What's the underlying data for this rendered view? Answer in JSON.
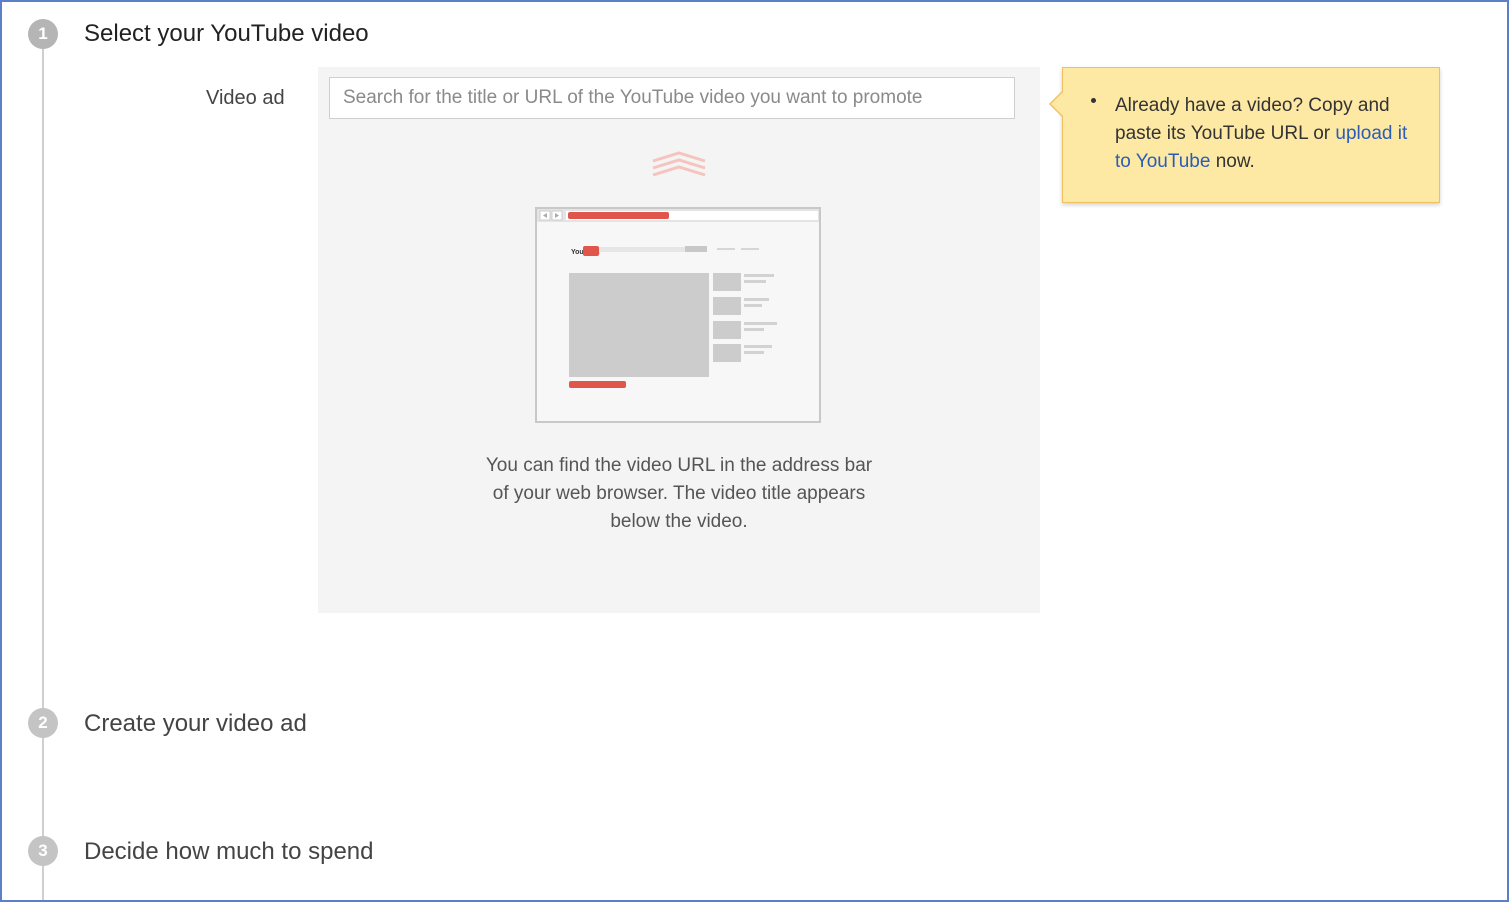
{
  "steps": [
    {
      "number": "1",
      "title": "Select your YouTube video"
    },
    {
      "number": "2",
      "title": "Create your video ad"
    },
    {
      "number": "3",
      "title": "Decide how much to spend"
    }
  ],
  "video_field": {
    "label": "Video ad",
    "placeholder": "Search for the title or URL of the YouTube video you want to promote",
    "value": ""
  },
  "help_text": "You can find the video URL in the address bar of your web browser. The video title appears below the video.",
  "illustration": {
    "logo_text": "YouTube"
  },
  "tooltip": {
    "text_before": "Already have a video? Copy and paste its YouTube URL or ",
    "link_text": "upload it to YouTube",
    "text_after": " now."
  },
  "colors": {
    "accent_red": "#e0564a",
    "tooltip_bg": "#fde9a4",
    "link_blue": "#2a5cb8",
    "frame_border": "#5b80c8"
  }
}
